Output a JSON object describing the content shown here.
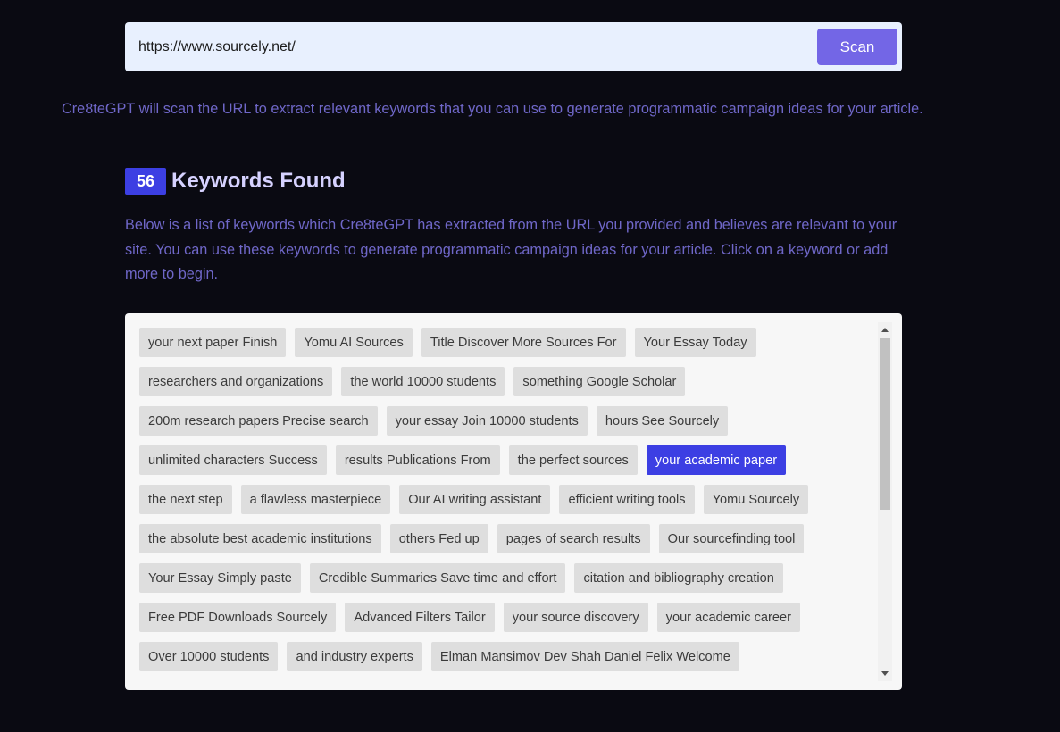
{
  "url_bar": {
    "value": "https://www.sourcely.net/",
    "scan_label": "Scan"
  },
  "intro_text": "Cre8teGPT will scan the URL to extract relevant keywords that you can use to generate programmatic campaign ideas for your article.",
  "keywords_header": {
    "count": "56",
    "title": "Keywords Found"
  },
  "description": "Below is a list of keywords which Cre8teGPT has extracted from the URL you provided and believes are relevant to your site. You can use these keywords to generate programmatic campaign ideas for your article. Click on a keyword or add more to begin.",
  "keywords": [
    "your next paper Finish",
    "Yomu AI Sources",
    "Title Discover More Sources For",
    "Your Essay Today",
    "researchers and organizations",
    "the world 10000 students",
    "something Google Scholar",
    "200m research papers Precise search",
    "your essay Join 10000 students",
    "hours See Sourcely",
    "unlimited characters Success",
    "results Publications From",
    "the perfect sources",
    "your academic paper",
    "the next step",
    "a flawless masterpiece",
    "Our AI writing assistant",
    "efficient writing tools",
    "Yomu Sourcely",
    "the absolute best academic institutions",
    "others Fed up",
    "pages of search results",
    "Our sourcefinding tool",
    "Your Essay Simply paste",
    "Credible Summaries Save time and effort",
    "citation and bibliography creation",
    "Free PDF Downloads Sourcely",
    "Advanced Filters Tailor",
    "your source discovery",
    "your academic career",
    "Over 10000 students",
    "and industry experts",
    "Elman Mansimov Dev Shah Daniel Felix Welcome"
  ],
  "selected_keyword": "your academic paper",
  "colors": {
    "background": "#0a0a12",
    "accent": "#3c3fe3",
    "scan_button": "#7366e6",
    "muted_text": "#6f67c8"
  }
}
